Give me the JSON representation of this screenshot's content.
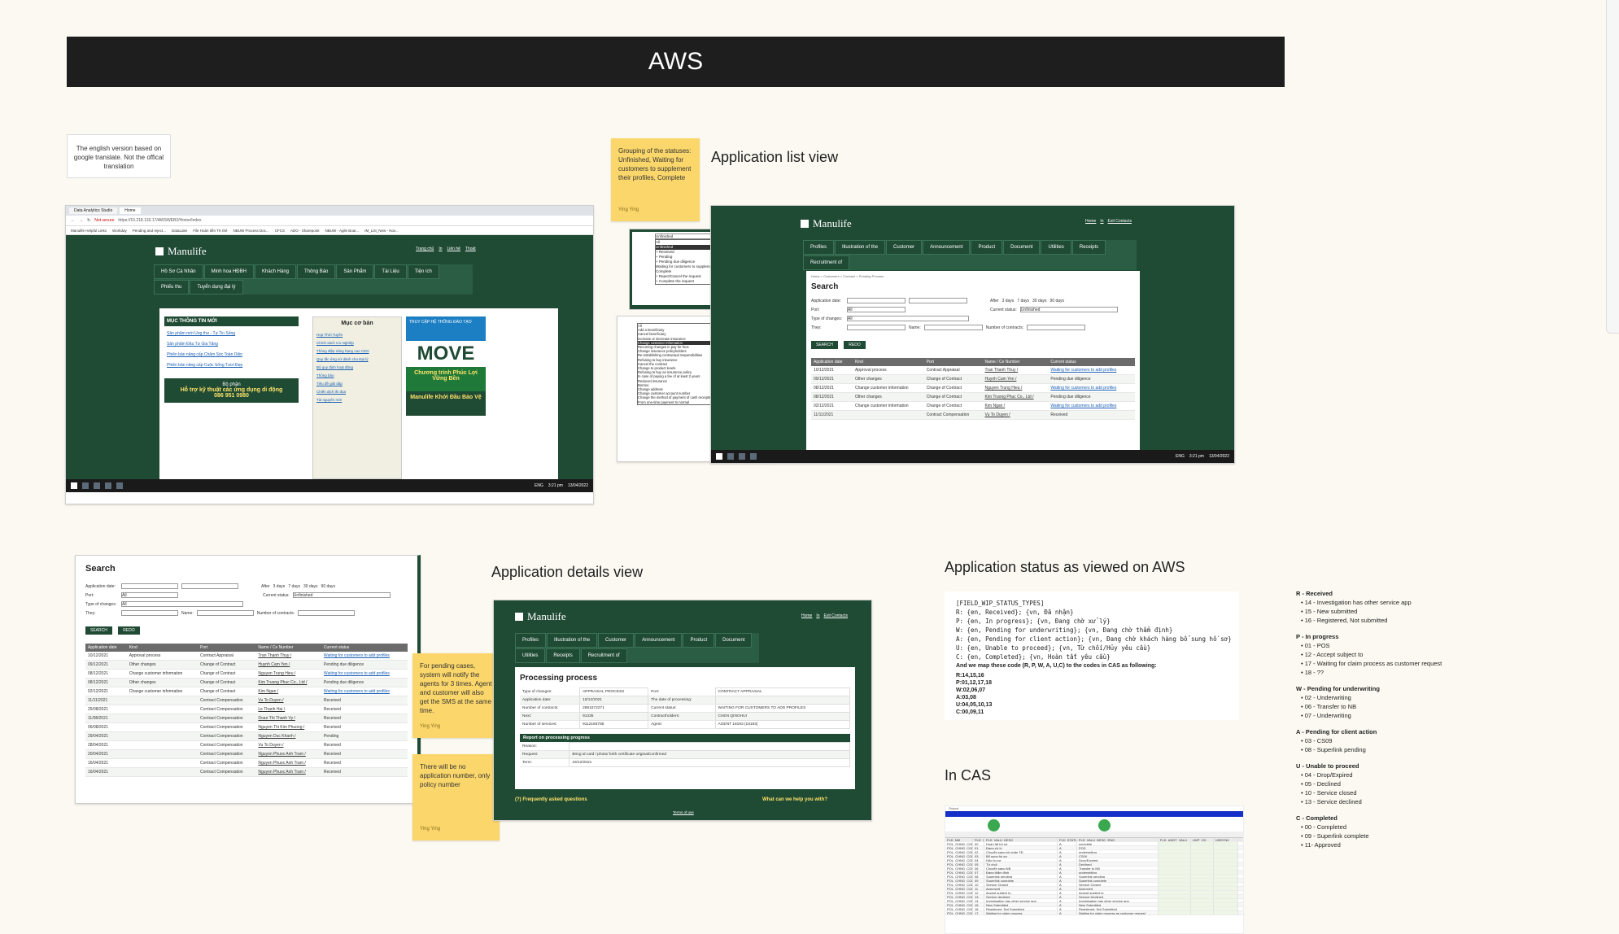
{
  "title": "AWS",
  "translation_note": "The english version based on google translate. Not the offical translation",
  "sections": {
    "app_list": "Application list view",
    "app_details": "Application details view",
    "status_aws": "Application status as viewed on AWS",
    "in_cas": "In CAS"
  },
  "stickies": {
    "grouping": {
      "text": "Grouping of the statuses: Unfinished, Waiting for customers to supplement their profiles, Complete",
      "author": "Ying Ying"
    },
    "pending": {
      "text": "For pending cases, system will notify the agents for 3 times. Agent and customer will also get the SMS at the same time.",
      "author": "Ying Ying"
    },
    "no_app_number": {
      "text": "There will be no application number, only policy number",
      "author": "Ying Ying"
    }
  },
  "browser": {
    "tabs": [
      "Data Analytics Studio",
      "Home"
    ],
    "url": "https://10.218.133.17/AWSWEB2/Home/Index",
    "not_secure": "Not secure",
    "bookmarks": [
      "Manulife Helpful Links",
      "Workday",
      "Pending and reject...",
      "DataLake",
      "File Hoàn tiền TK thẻ",
      "NBUW Process Doc...",
      "CFCS",
      "ADO - Sharepoint",
      "NBUW - Agile Boar...",
      "IM_List_New - Nov..."
    ]
  },
  "portal": {
    "brand": "Manulife",
    "top_links": [
      "Trang chủ",
      "In",
      "Liên hệ",
      "Thoát"
    ],
    "nav": [
      "Hồ Sơ Cá Nhân",
      "Minh hoa HĐBH",
      "Khách Hàng",
      "Thông Báo",
      "Sản Phẩm",
      "Tài Liệu",
      "Tiện ích",
      "Phiếu thu",
      "Tuyển dụng đại lý"
    ],
    "news_title": "MỤC THÔNG TIN MỚI",
    "news": [
      "Sản phẩm mới Ung thư - Tự Tin Sống",
      "Sản phẩm Đầu Tư Gia Tăng",
      "Phiên bản nâng cấp Chăm Sóc Toàn Diện",
      "Phiên bản nâng cấp Cuộc Sống Tươi Đẹp"
    ],
    "support_title": "Bộ phận",
    "support_text": "Hỗ trợ kỹ thuật các ứng dụng di động",
    "support_phone": "086 951 0980",
    "core_title": "Mục cơ bản",
    "core_links": [
      "Họp Thời Tuyển",
      "Chính sách Ưu Nghiệp",
      "Thông điệp nâng hạng cao CEO",
      "Quy tắc ứng xử dành cho Đại lý",
      "Bộ quy định hoạt động",
      "Thông báo",
      "Tiêu đề giải đáp",
      "Chiến dịch thi đua",
      "Tài nguyên mới"
    ],
    "banners": [
      "TRUY CẬP HỆ THỐNG ĐÀO TẠO",
      "MOVE",
      "Chương trình Phúc Lợi Vững Bền",
      "Manulife Khởi Đầu Bảo Vệ"
    ],
    "tasktime": "3:21 pm",
    "taskdate": "13/04/2022",
    "lang": "ENG"
  },
  "list_view": {
    "nav": [
      "Profiles",
      "Illustration of the",
      "Customer",
      "Announcement",
      "Product",
      "Document",
      "Utilities",
      "Receipts",
      "Recruitment of"
    ],
    "top_links": [
      "Home",
      "In",
      "Exit Contacts"
    ],
    "breadcrumb": "Home > Customers > Contract > Pending Process",
    "search_title": "Search",
    "labels": {
      "app_date": "Application date:",
      "after": "After",
      "port": "Port:",
      "status": "Current status:",
      "type": "Type of changes:",
      "they": "They:",
      "name": "Name:",
      "contracts": "Number of contracts:"
    },
    "days": [
      "3 days",
      "7 days",
      "30 days",
      "90 days"
    ],
    "port_value": "All",
    "status_value": "Unfinished",
    "buttons": [
      "SEARCH",
      "REDO"
    ],
    "columns": [
      "Application date",
      "Kind",
      "Port",
      "Name / Ce Number",
      "Current status"
    ],
    "rows": [
      [
        "10/12/2021",
        "Approval process",
        "Contract Appraisal",
        "Tran Thanh Thuy /",
        "Waiting for customers to add profiles"
      ],
      [
        "09/12/2021",
        "Other changes",
        "Change of Contract",
        "Huynh Cam Yen /",
        "Pending due diligence"
      ],
      [
        "08/12/2021",
        "Change customer information",
        "Change of Contract",
        "Nguyen Trung Hieu /",
        "Waiting for customers to add profiles"
      ],
      [
        "08/12/2021",
        "Other changes",
        "Change of Contract",
        "Kim Truong Phuc Co., Ltd /",
        "Pending due diligence"
      ],
      [
        "02/12/2021",
        "Change customer information",
        "Change of Contract",
        "Kim Ngan /",
        "Waiting for customers to add profiles"
      ],
      [
        "11/11/2021",
        "",
        "Contract Compensation",
        "Vu To Duyen /",
        "Received"
      ]
    ],
    "status_dropdown": [
      "All",
      "Unfinished",
      "+ Received",
      "+ Pending",
      "+ Pending due diligence",
      "Waiting for customers to supplement their profiles",
      "Complete",
      "+ Reject/Cancel the request",
      "+ Complete the request"
    ],
    "type_dropdown": [
      "All",
      "Add a beneficiary",
      "Cancel beneficiary",
      "Increase or decrease insurance",
      "Change customer information",
      "Recurring changes in pay for fees",
      "Change insurance policyholders",
      "Re-establishing contractual responsibilities",
      "Refusing to buy insurance",
      "Cancel the contract",
      "Change to product levels",
      "Refusing to buy an insurance policy",
      "In case of paying a fee of at least 2 years",
      "Reduced insurance",
      "Borrow",
      "Change address",
      "Change customer account number",
      "Change the method of payment of cash receipts",
      "From one-time payment to normal"
    ],
    "tasktime": "3:21 pm",
    "taskdate": "13/04/2022",
    "lang": "ENG"
  },
  "search_panel": {
    "title": "Search",
    "rows": [
      [
        "10/12/2021",
        "Approval process",
        "Contract Appraisal",
        "Tran Thanh Thuy /",
        "Waiting for customers to add profiles"
      ],
      [
        "09/12/2021",
        "Other changes",
        "Change of Contract",
        "Huynh Cam Yen /",
        "Pending due diligence"
      ],
      [
        "08/12/2021",
        "Change customer information",
        "Change of Contract",
        "Nguyen Trung Hieu /",
        "Waiting for customers to add profiles"
      ],
      [
        "08/12/2021",
        "Other changes",
        "Change of Contract",
        "Kim Truong Phuc Co., Ltd /",
        "Pending due diligence"
      ],
      [
        "02/12/2021",
        "Change customer information",
        "Change of Contract",
        "Kim Ngan /",
        "Waiting for customers to add profiles"
      ],
      [
        "11/11/2021",
        "",
        "Contract Compensation",
        "Vu To Duyen /",
        "Received"
      ],
      [
        "25/08/2021",
        "",
        "Contract Compensation",
        "Le Thanh Hai /",
        "Received"
      ],
      [
        "11/08/2021",
        "",
        "Contract Compensation",
        "Doan Thi Thanh Vy /",
        "Received"
      ],
      [
        "06/08/2021",
        "",
        "Contract Compensation",
        "Nguyen Thi Kim Phuong /",
        "Received"
      ],
      [
        "29/04/2021",
        "",
        "Contract Compensation",
        "Nguyen Duc Khanh /",
        "Pending"
      ],
      [
        "28/04/2021",
        "",
        "Contract Compensation",
        "Vu To Duyen /",
        "Received"
      ],
      [
        "20/04/2021",
        "",
        "Contract Compensation",
        "Nguyen Phuoc Anh Tram /",
        "Received"
      ],
      [
        "16/04/2021",
        "",
        "Contract Compensation",
        "Nguyen Phuoc Anh Tram /",
        "Received"
      ],
      [
        "16/04/2021",
        "",
        "Contract Compensation",
        "Nguyen Phuoc Anh Tram /",
        "Received"
      ]
    ]
  },
  "details": {
    "title": "Processing process",
    "fields": [
      [
        "Type of changes:",
        "APPRAISAL PROCESS",
        "Port:",
        "CONTRACT APPRAISAL"
      ],
      [
        "Application date:",
        "10/12/2021",
        "The date of processing:",
        ""
      ],
      [
        "Number of contracts:",
        "2891572271",
        "Current status:",
        "WAITING FOR CUSTOMERS TO ADD PROFILES"
      ],
      [
        "Next:",
        "91335",
        "Contractholders:",
        "CHEN QINGHUI"
      ],
      [
        "Number of services:",
        "9112155785",
        "Agent:",
        "AGENT 18193 (18193)"
      ]
    ],
    "report_title": "Report on processing progress",
    "report": [
      [
        "Reason:",
        ""
      ],
      [
        "Request:",
        "Bring id card / photo/ birth certificate originalConfirmed"
      ],
      [
        "Term:",
        "23/12/2021"
      ]
    ],
    "faq": "(?) Frequently asked questions",
    "help": "What can we help you with?",
    "terms": "Terms of use"
  },
  "status_code": "[FIELD_WIP_STATUS_TYPES]\nR: {en, Received}; {vn, Đã nhận}\nP: {en, In progress}; {vn, Đang chờ xử lý}\nW: {en, Pending for underwriting}; {vn, Đang chờ thẩm định}\nA: {en, Pending for client action}; {vn, Đang chờ khách hàng bổ sung hồ sơ}\nU: {en, Unable to proceed}; {vn, Từ chối/Hủy yêu cầu}\nC: {en, Completed}; {vn, Hoàn tất yêu cầu}",
  "status_map_title": "And we map these code (R, P, W, A, U,C) to the codes in CAS as following:",
  "status_map": [
    "R:14,15,16",
    "P:01,12,17,18",
    "W:02,06,07",
    "A:03,08",
    "U:04,05,10,13",
    "C:00,09,11"
  ],
  "cas_groups": [
    {
      "title": "R - Received",
      "items": [
        "14 - Investigation has other service app",
        "15 - New submitted",
        "16 - Registered, Not submitted"
      ]
    },
    {
      "title": "P - In progress",
      "items": [
        "01 - POS",
        "12 - Accept subject to",
        "17 - Waiting for claim process as customer request",
        "18 - ??"
      ]
    },
    {
      "title": "W - Pending for underwriting",
      "items": [
        "02 - Underwriting",
        "06 - Transfer to NB",
        "07 - Underwriting"
      ]
    },
    {
      "title": "A - Pending for client action",
      "items": [
        "03 - CS09",
        "08 - Superlink pending"
      ]
    },
    {
      "title": "U - Unable to proceed",
      "items": [
        "04 - Drop/Expired",
        "05 - Declined",
        "10 - Service closed",
        "13 - Service declined"
      ]
    },
    {
      "title": "C - Completed",
      "items": [
        "00 - Completed",
        "09 - Superlink complete",
        "11- Approved"
      ]
    }
  ],
  "cas_table": {
    "columns": [
      "FLD_NM",
      "FLD_VALU",
      "FLD_VALU_DESC",
      "FLD_STATUS",
      "FLD_VALU_DESC_ENG",
      "FLD_ADDT_VALU",
      "LWP_CD",
      "LIBSYNC"
    ],
    "rows": [
      [
        "POL_CHNG_CODE",
        "00",
        "Hoàn tất hồ sơ",
        "A",
        "complete"
      ],
      [
        "POL_CHNG_CODE",
        "01",
        "Đang xử lý",
        "A",
        "POS"
      ],
      [
        "POL_CHNG_CODE",
        "02",
        "Chuyển sang bộ phận TĐ",
        "A",
        "underwriting"
      ],
      [
        "POL_CHNG_CODE",
        "03",
        "Bổ sung hồ sơ",
        "A",
        "CS09"
      ],
      [
        "POL_CHNG_CODE",
        "04",
        "Hủy hồ sơ",
        "A",
        "Drop/Expired"
      ],
      [
        "POL_CHNG_CODE",
        "05",
        "Từ chối",
        "A",
        "Declined"
      ],
      [
        "POL_CHNG_CODE",
        "06",
        "Chuyển sang NB",
        "A",
        "Transfer to NB"
      ],
      [
        "POL_CHNG_CODE",
        "07",
        "Đang thẩm định",
        "A",
        "underwriting"
      ],
      [
        "POL_CHNG_CODE",
        "08",
        "Superlink pending",
        "A",
        "Superlink pending"
      ],
      [
        "POL_CHNG_CODE",
        "09",
        "Superlink complete",
        "A",
        "Superlink complete"
      ],
      [
        "POL_CHNG_CODE",
        "10",
        "Service Closed",
        "A",
        "Service Closed"
      ],
      [
        "POL_CHNG_CODE",
        "11",
        "Approved",
        "A",
        "Approved"
      ],
      [
        "POL_CHNG_CODE",
        "12",
        "Accept subject to",
        "A",
        "Accept subject to"
      ],
      [
        "POL_CHNG_CODE",
        "13",
        "Service declined",
        "A",
        "Service Declined"
      ],
      [
        "POL_CHNG_CODE",
        "14",
        "Investigation has other service app",
        "A",
        "Investigation has other service app"
      ],
      [
        "POL_CHNG_CODE",
        "15",
        "New Submitted",
        "A",
        "New Submitted"
      ],
      [
        "POL_CHNG_CODE",
        "16",
        "Registered, Not Submitted",
        "A",
        "Registered, Not Submitted"
      ],
      [
        "POL_CHNG_CODE",
        "17",
        "Waiting for claim process",
        "A",
        "Waiting for claim process as customer request"
      ]
    ]
  }
}
